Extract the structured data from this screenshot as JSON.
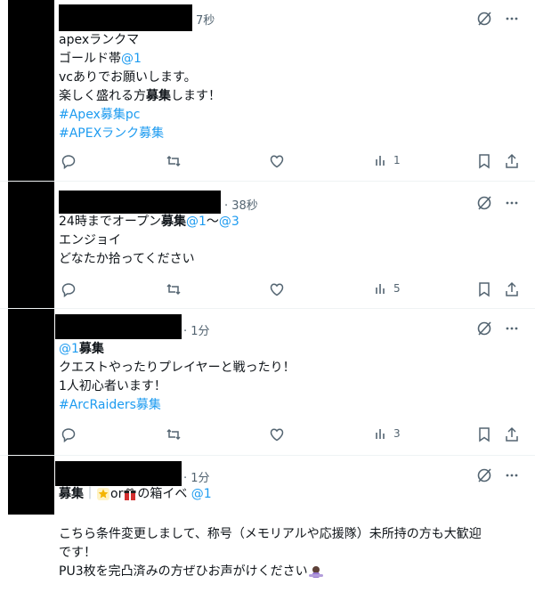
{
  "tweets": [
    {
      "time": "7秒",
      "lines": [
        {
          "parts": [
            {
              "t": "apexランクマ",
              "k": "text"
            }
          ]
        },
        {
          "parts": [
            {
              "t": "ゴールド帯",
              "k": "text"
            },
            {
              "t": "@1",
              "k": "mention"
            }
          ]
        },
        {
          "parts": [
            {
              "t": "vcありでお願いします。",
              "k": "text"
            }
          ]
        },
        {
          "parts": [
            {
              "t": "楽しく盛れる方",
              "k": "text"
            },
            {
              "t": "募集",
              "k": "bold"
            },
            {
              "t": "します！",
              "k": "text"
            }
          ]
        },
        {
          "parts": [
            {
              "t": "#Apex募集pc",
              "k": "tag"
            }
          ]
        },
        {
          "parts": [
            {
              "t": "#APEXランク募集",
              "k": "tag"
            }
          ]
        }
      ],
      "views": "1"
    },
    {
      "time": "· 38秒",
      "lines": [
        {
          "parts": [
            {
              "t": "24時までオープン",
              "k": "text"
            },
            {
              "t": "募集",
              "k": "bold"
            },
            {
              "t": "@1",
              "k": "mention"
            },
            {
              "t": "〜",
              "k": "text"
            },
            {
              "t": "@3",
              "k": "mention"
            }
          ]
        },
        {
          "parts": [
            {
              "t": "エンジョイ",
              "k": "text"
            }
          ]
        },
        {
          "parts": [
            {
              "t": "どなたか拾ってください",
              "k": "text"
            }
          ]
        }
      ],
      "views": "5"
    },
    {
      "time": "· 1分",
      "lines": [
        {
          "parts": [
            {
              "t": "@1",
              "k": "mention"
            },
            {
              "t": "募集",
              "k": "bold"
            }
          ]
        },
        {
          "parts": [
            {
              "t": "クエストやったりプレイヤーと戦ったり！",
              "k": "text"
            }
          ]
        },
        {
          "parts": [
            {
              "t": "1人初心者います！",
              "k": "text"
            }
          ]
        },
        {
          "parts": [
            {
              "t": " #ArcRaiders募集",
              "k": "tag"
            }
          ]
        }
      ],
      "views": "3"
    },
    {
      "time": "· 1分",
      "line1": {
        "bold": "募集",
        "sep": "｜",
        "or": "or",
        "rest": "の箱イベ ",
        "mention": "@1"
      },
      "lines": [
        {
          "parts": [
            {
              "t": "こちら条件変更しまして、称号（メモリアルや応援隊）未所持の方も大歓迎",
              "k": "text"
            }
          ]
        },
        {
          "parts": [
            {
              "t": "です！",
              "k": "text"
            }
          ]
        },
        {
          "parts": [
            {
              "t": "PU3枚を完凸済みの方ぜひお声がけください",
              "k": "text"
            }
          ]
        }
      ]
    }
  ],
  "icons": {
    "grok": "grok-icon",
    "more": "more-icon",
    "reply": "reply-icon",
    "retweet": "retweet-icon",
    "like": "like-icon",
    "views": "views-icon",
    "bookmark": "bookmark-icon",
    "share": "share-icon"
  },
  "colors": {
    "link": "#1d9bf0",
    "muted": "#536471",
    "text": "#0f1419"
  }
}
